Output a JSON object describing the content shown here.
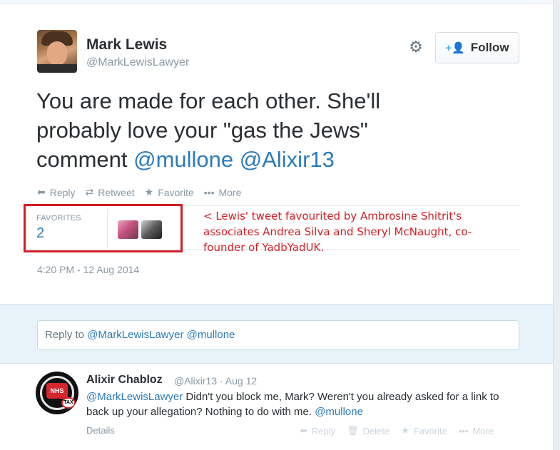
{
  "tweet": {
    "author_name": "Mark Lewis",
    "author_handle": "@MarkLewisLawyer",
    "follow_label": "Follow",
    "text_before": "You are made for each other. She'll probably love your \"gas the Jews\" comment ",
    "mention_1": "@mullone",
    "mention_2": "@Alixir13",
    "actions": {
      "reply": "Reply",
      "retweet": "Retweet",
      "favorite": "Favorite",
      "more": "More"
    },
    "favorites_label": "FAVORITES",
    "favorites_count": "2",
    "timestamp": "4:20 PM - 12 Aug 2014"
  },
  "annotation": "< Lewis' tweet favourited by Ambrosine Shitrit's associates Andrea Silva and Sheryl McNaught, co-founder of YadbYadUK.",
  "reply_box": {
    "prefix": "Reply to ",
    "mentions": "@MarkLewisLawyer @mullone"
  },
  "reply_tweet": {
    "author_name": "Alixir Chabloz",
    "meta": "@Alixir13 · Aug 12",
    "mention_start": "@MarkLewisLawyer",
    "text": " Didn't you block me, Mark? Weren't you already asked for a link to back up your allegation? Nothing to do with me. ",
    "mention_end": "@mullone",
    "details": "Details",
    "actions": {
      "reply": "Reply",
      "delete": "Delete",
      "favorite": "Favorite",
      "more": "More"
    },
    "avatar_text": "NHS",
    "avatar_badge": "TAX"
  },
  "colors": {
    "link": "#2b7bb9",
    "annotation": "#d21f26",
    "muted": "#8899a6"
  },
  "icons": [
    "gear-icon",
    "follow-person-icon",
    "reply-icon",
    "retweet-icon",
    "favorite-star-icon",
    "more-dots-icon",
    "delete-icon"
  ]
}
